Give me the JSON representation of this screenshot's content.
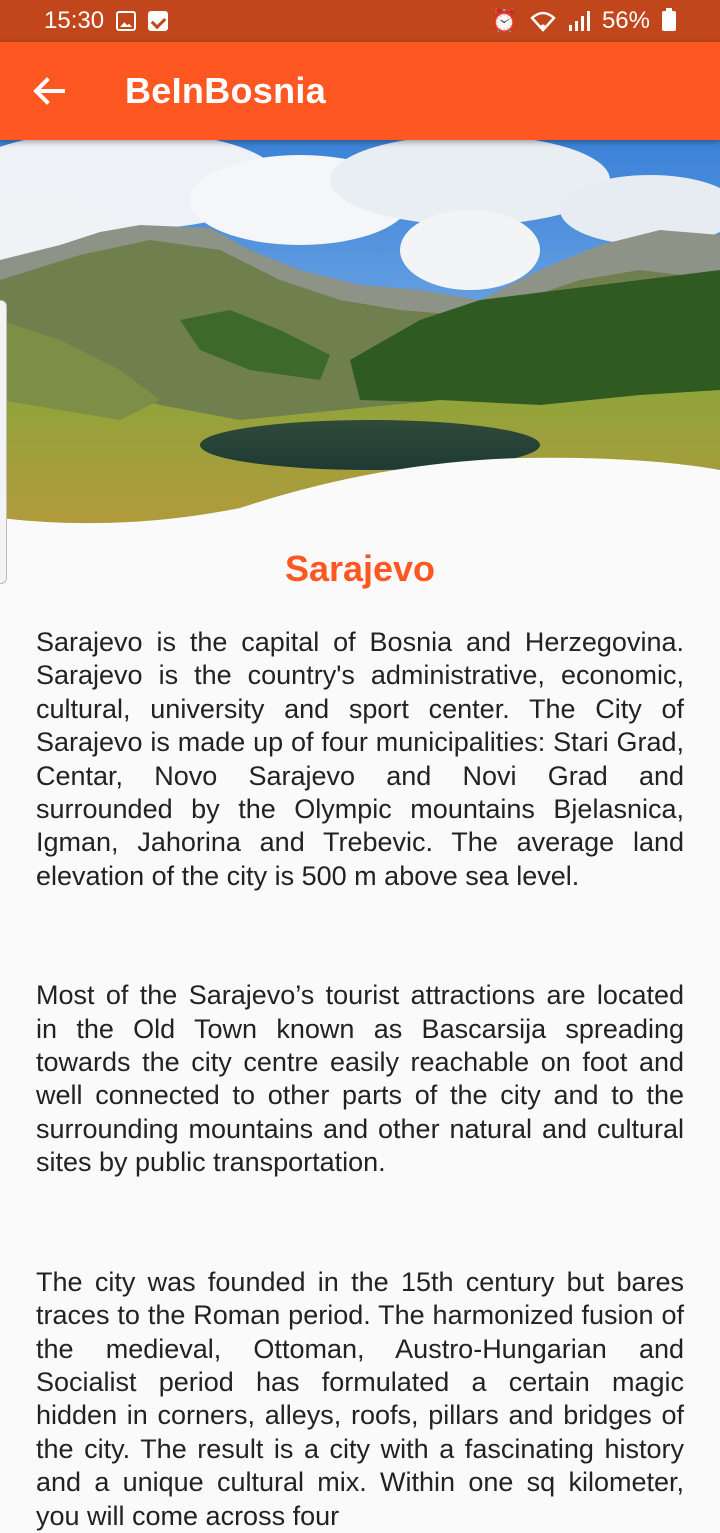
{
  "status_bar": {
    "time": "15:30",
    "battery": "56%"
  },
  "app_bar": {
    "title": "BeInBosnia",
    "back_icon": "arrow-back-icon"
  },
  "hero": {
    "image": "mountain-lake-landscape"
  },
  "article": {
    "title": "Sarajevo",
    "paragraphs": [
      "Sarajevo is the capital of Bosnia and Herzegovina. Sarajevo is the country's administrative, economic, cultural, university and sport center. The City of Sarajevo is made up of four municipalities: Stari Grad, Centar, Novo Sarajevo and Novi Grad and surrounded by the Olympic mountains Bjelasnica, Igman, Jahorina and Trebevic.  The average land elevation of the city is 500 m above sea level.",
      "Most of the Sarajevo’s tourist attractions are located in the Old Town known as Bascarsija spreading towards the city centre easily reachable on foot and well connected to other parts of the city and to the surrounding mountains and other natural and cultural sites by public transportation.",
      "The city was founded in the 15th century but bares traces to the Roman period. The harmonized fusion of the medieval, Ottoman, Austro-Hungarian and Socialist period has formulated a certain magic hidden in corners, alleys, roofs, pillars and bridges of the city. The result is a city with a fascinating history and a unique cultural mix. Within one sq kilometer, you will come across four"
    ]
  },
  "colors": {
    "status_bar": "#c1461c",
    "app_bar": "#ff5722",
    "title_accent": "#ff5722",
    "background": "#fafafa"
  }
}
